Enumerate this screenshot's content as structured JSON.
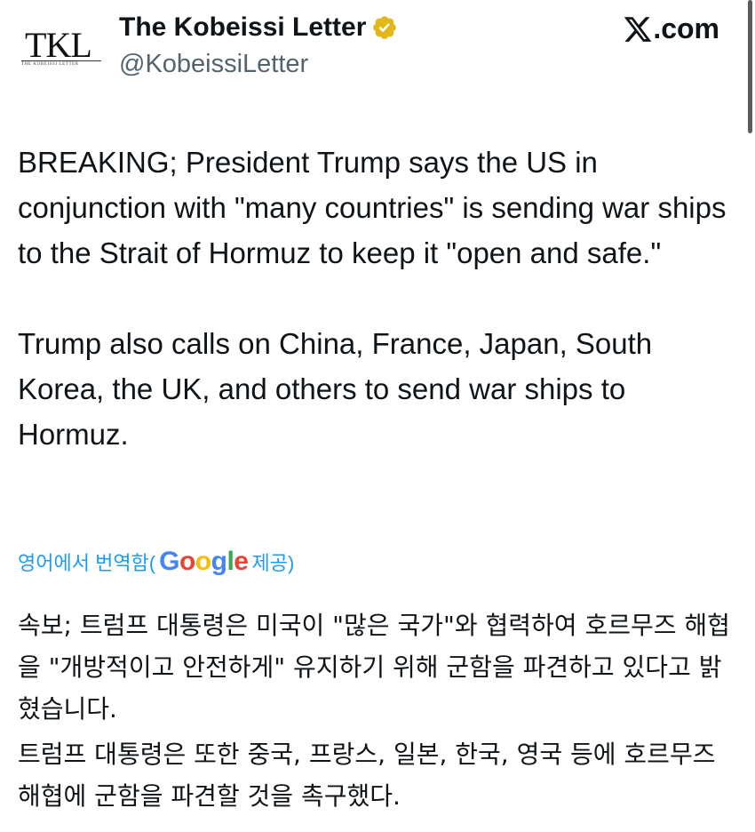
{
  "account": {
    "avatar_text": "TKL",
    "avatar_subtext": "THE KOBEISSI LETTER",
    "display_name": "The Kobeissi Letter",
    "handle": "@KobeissiLetter"
  },
  "brand": {
    "site": ".com"
  },
  "tweet": {
    "paragraphs": [
      "BREAKING; President Trump says the US in conjunction with \"many countries\" is sending war ships to the Strait of Hormuz to keep it \"open and safe.\"",
      "Trump also calls on China, France, Japan, South Korea, the UK, and others to send war ships to Hormuz."
    ]
  },
  "translation": {
    "prefix": "영어에서 번역함(",
    "google": [
      "G",
      "o",
      "o",
      "g",
      "l",
      "e"
    ],
    "suffix": " 제공)",
    "paragraphs": [
      "속보; 트럼프 대통령은 미국이 \"많은 국가\"와 협력하여 호르무즈 해협을 \"개방적이고 안전하게\" 유지하기 위해 군함을 파견하고 있다고 밝혔습니다.",
      "트럼프 대통령은 또한 중국, 프랑스, 일본, 한국, 영국 등에 호르무즈 해협에 군함을 파견할 것을 촉구했다."
    ]
  },
  "icons": {
    "verified": "verified-badge-icon",
    "x_logo": "x-logo-icon"
  },
  "colors": {
    "verified_gold": "#e2b719",
    "link_blue": "#1d9bf0",
    "handle_gray": "#536471",
    "text": "#0f1419"
  }
}
